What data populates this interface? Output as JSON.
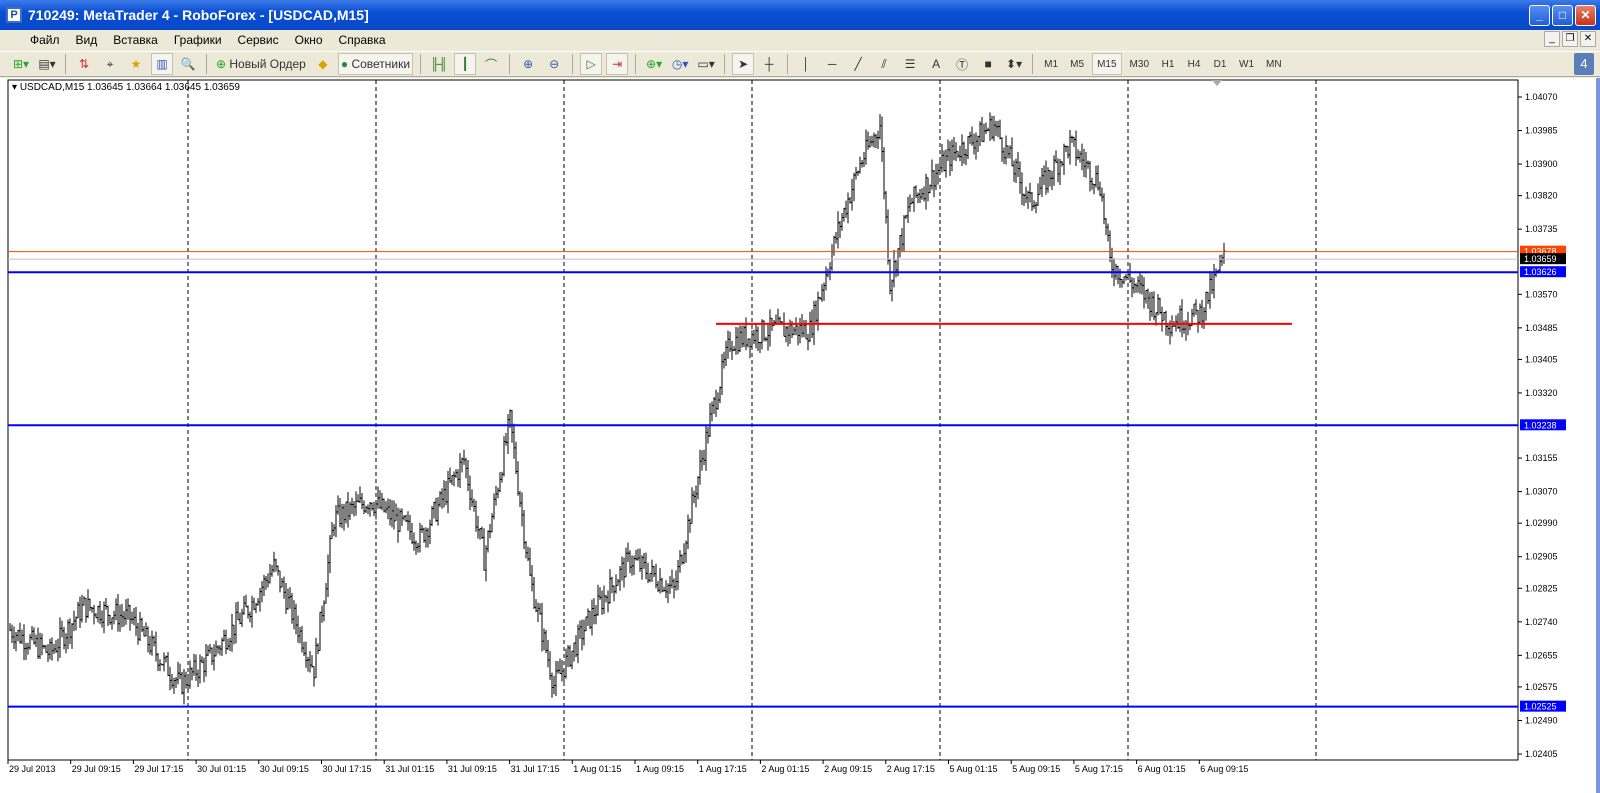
{
  "window": {
    "title": "710249: MetaTrader 4 - RoboForex - [USDCAD,M15]"
  },
  "menu": [
    "Файл",
    "Вид",
    "Вставка",
    "Графики",
    "Сервис",
    "Окно",
    "Справка"
  ],
  "toolbar": {
    "new_order": "Новый Ордер",
    "advisors": "Советники",
    "timeframes": [
      "M1",
      "M5",
      "M15",
      "M30",
      "H1",
      "H4",
      "D1",
      "W1",
      "MN"
    ],
    "active_timeframe": "M15",
    "notifications": "4"
  },
  "chart_info": "USDCAD,M15  1.03645 1.03664 1.03645 1.03659",
  "chart_data": {
    "type": "bar",
    "symbol": "USDCAD",
    "timeframe": "M15",
    "ylim": [
      1.02405,
      1.0407
    ],
    "yticks": [
      "1.04070",
      "1.03985",
      "1.03900",
      "1.03820",
      "1.03735",
      "1.03570",
      "1.03485",
      "1.03405",
      "1.03320",
      "1.03155",
      "1.03070",
      "1.02990",
      "1.02905",
      "1.02825",
      "1.02740",
      "1.02655",
      "1.02575",
      "1.02490",
      "1.02405"
    ],
    "xticks": [
      "29 Jul 2013",
      "29 Jul 09:15",
      "29 Jul 17:15",
      "30 Jul 01:15",
      "30 Jul 09:15",
      "30 Jul 17:15",
      "31 Jul 01:15",
      "31 Jul 09:15",
      "31 Jul 17:15",
      "1 Aug 01:15",
      "1 Aug 09:15",
      "1 Aug 17:15",
      "2 Aug 01:15",
      "2 Aug 09:15",
      "2 Aug 17:15",
      "5 Aug 01:15",
      "5 Aug 09:15",
      "5 Aug 17:15",
      "6 Aug 01:15",
      "6 Aug 09:15"
    ],
    "price_path": [
      [
        0,
        1.0272
      ],
      [
        20,
        1.0266
      ],
      [
        37,
        1.0278
      ],
      [
        60,
        1.0275
      ],
      [
        85,
        1.0258
      ],
      [
        100,
        1.0265
      ],
      [
        120,
        1.0278
      ],
      [
        132,
        1.0288
      ],
      [
        152,
        1.0262
      ],
      [
        162,
        1.03
      ],
      [
        180,
        1.0305
      ],
      [
        205,
        1.0295
      ],
      [
        227,
        1.0315
      ],
      [
        237,
        1.029
      ],
      [
        250,
        1.0325
      ],
      [
        260,
        1.0285
      ],
      [
        272,
        1.0258
      ],
      [
        290,
        1.0275
      ],
      [
        310,
        1.029
      ],
      [
        332,
        1.0282
      ],
      [
        350,
        1.0325
      ],
      [
        360,
        1.0345
      ],
      [
        380,
        1.0348
      ],
      [
        400,
        1.0348
      ],
      [
        415,
        1.0375
      ],
      [
        425,
        1.039
      ],
      [
        435,
        1.04
      ],
      [
        440,
        1.036
      ],
      [
        450,
        1.038
      ],
      [
        470,
        1.0392
      ],
      [
        492,
        1.04
      ],
      [
        510,
        1.038
      ],
      [
        530,
        1.0395
      ],
      [
        545,
        1.0385
      ],
      [
        550,
        1.0365
      ],
      [
        565,
        1.0358
      ],
      [
        580,
        1.035
      ],
      [
        595,
        1.0352
      ],
      [
        607,
        1.0366
      ]
    ],
    "levels": [
      {
        "price": 1.03678,
        "label": "1.03678",
        "color": "#ff4500",
        "kind": "ask"
      },
      {
        "price": 1.03659,
        "label": "1.03659",
        "color": "#c0c0c0",
        "kind": "bid"
      },
      {
        "price": 1.03626,
        "label": "1.03626",
        "color": "#0000ff",
        "kind": "hline"
      },
      {
        "price": 1.03238,
        "label": "1.03238",
        "color": "#0000ff",
        "kind": "hline"
      },
      {
        "price": 1.02525,
        "label": "1.02525",
        "color": "#0000ff",
        "kind": "hline"
      }
    ],
    "trendline": {
      "price": 1.03495,
      "from_bar": 353,
      "to_bar": 641,
      "color": "#ff0000"
    }
  }
}
